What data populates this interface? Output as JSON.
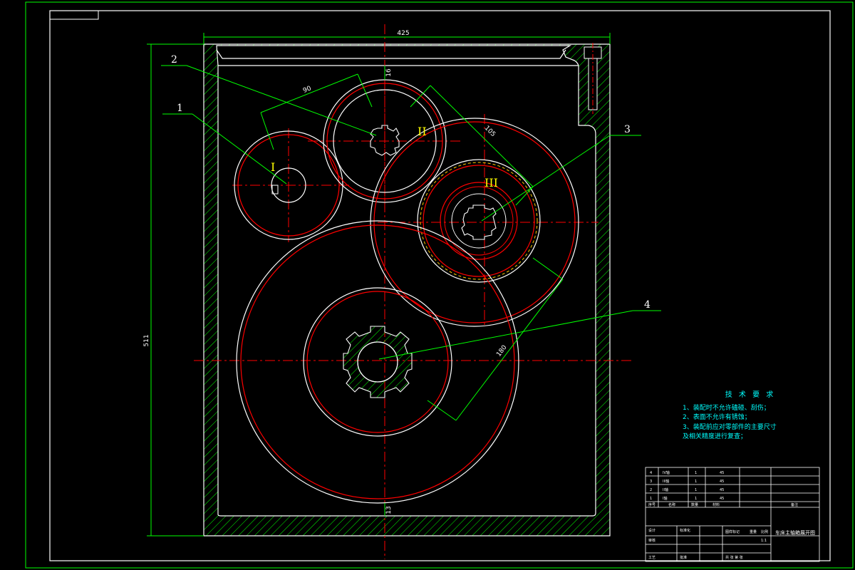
{
  "drawing": {
    "dimensions": {
      "width": "425",
      "height": "511",
      "center_distance_1_2": "90",
      "center_distance_2_3": "105",
      "center_distance_3_4": "180",
      "bottom_gap": "13",
      "top_gap": "16"
    },
    "leaders": [
      "1",
      "2",
      "3",
      "4"
    ],
    "shaft_labels": [
      "I",
      "II",
      "III"
    ]
  },
  "tech_requirements": {
    "title": "技 术 要 求",
    "notes": [
      "1、装配时不允许磕碰、刮伤；",
      "2、表面不允许有锈蚀；",
      "3、装配前应对零部件的主要尺寸",
      "及相关精度进行复查；"
    ]
  },
  "parts_list": {
    "rows": [
      {
        "no": "4",
        "name": "IV轴",
        "qty": "1",
        "mat": "45"
      },
      {
        "no": "3",
        "name": "III轴",
        "qty": "1",
        "mat": "45"
      },
      {
        "no": "2",
        "name": "II轴",
        "qty": "1",
        "mat": "45"
      },
      {
        "no": "1",
        "name": "I轴",
        "qty": "1",
        "mat": "45"
      }
    ],
    "header": {
      "no": "序号",
      "name": "名称",
      "qty": "数量",
      "mat": "材料",
      "note": "备注"
    }
  },
  "title_block": {
    "title": "车床主轴箱展开图",
    "labels": [
      "设计",
      "标准化",
      "审核",
      "工艺",
      "批准",
      "图样标记",
      "重量",
      "比例",
      "共 张 第 张"
    ],
    "scale": "1:1"
  }
}
